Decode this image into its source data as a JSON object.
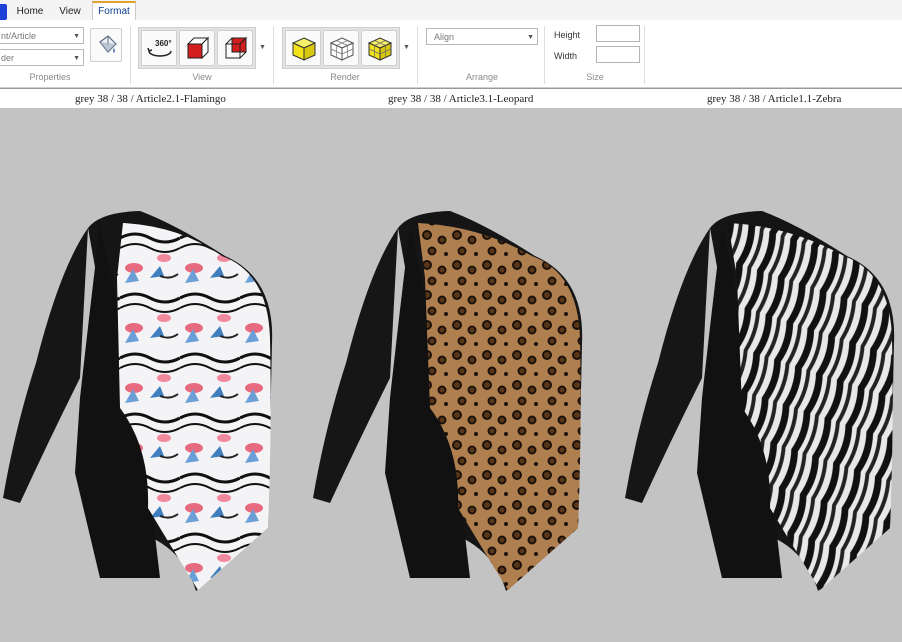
{
  "tabs": [
    {
      "label": "Home"
    },
    {
      "label": "View"
    },
    {
      "label": "Format",
      "active": true
    }
  ],
  "ribbon": {
    "properties": {
      "combo1_value": "nt/Article",
      "combo2_value": "der",
      "label": "Properties"
    },
    "view": {
      "label": "View",
      "rotate_360_text": "360°"
    },
    "render": {
      "label": "Render"
    },
    "arrange": {
      "align_value": "Align",
      "label": "Arrange"
    },
    "size": {
      "height_label": "Height",
      "width_label": "Width",
      "height_value": "",
      "width_value": "",
      "label": "Size"
    }
  },
  "captions": [
    "grey 38 / 38 / Article2.1-Flamingo",
    "grey 38 / 38 / Article3.1-Leopard",
    "grey 38 / 38 / Article1.1-Zebra"
  ],
  "colors": {
    "canvas_bg": "#c3c3c3",
    "accent": "#e0a22b",
    "cube_red": "#d41e1e",
    "cube_yellow": "#f1e21a"
  },
  "icons": {
    "fill": "paint-bucket-icon",
    "rotate": "rotate-360-icon",
    "cube_solid_red": "cube-red-solid-icon",
    "cube_wire_red": "cube-red-wire-icon",
    "cube_yellow": "cube-yellow-icon",
    "cube_wire": "cube-wireframe-icon",
    "cube_yellow_grid": "cube-yellow-grid-icon"
  }
}
